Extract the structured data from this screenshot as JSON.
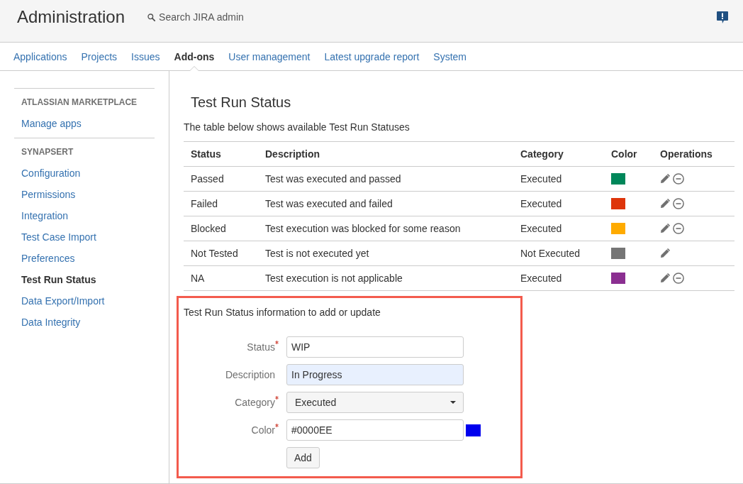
{
  "header": {
    "title": "Administration",
    "search": {
      "placeholder": "Search JIRA admin"
    }
  },
  "nav_tabs": [
    {
      "label": "Applications",
      "selected": false
    },
    {
      "label": "Projects",
      "selected": false
    },
    {
      "label": "Issues",
      "selected": false
    },
    {
      "label": "Add-ons",
      "selected": true
    },
    {
      "label": "User management",
      "selected": false
    },
    {
      "label": "Latest upgrade report",
      "selected": false
    },
    {
      "label": "System",
      "selected": false
    }
  ],
  "sidebar": {
    "sections": [
      {
        "heading": "ATLASSIAN MARKETPLACE",
        "items": [
          {
            "label": "Manage apps",
            "selected": false
          }
        ]
      },
      {
        "heading": "SYNAPSERT",
        "items": [
          {
            "label": "Configuration",
            "selected": false
          },
          {
            "label": "Permissions",
            "selected": false
          },
          {
            "label": "Integration",
            "selected": false
          },
          {
            "label": "Test Case Import",
            "selected": false
          },
          {
            "label": "Preferences",
            "selected": false
          },
          {
            "label": "Test Run Status",
            "selected": true
          },
          {
            "label": "Data Export/Import",
            "selected": false
          },
          {
            "label": "Data Integrity",
            "selected": false
          }
        ]
      }
    ]
  },
  "page": {
    "title": "Test Run Status",
    "intro": "The table below shows available Test Run Statuses"
  },
  "table": {
    "columns": [
      "Status",
      "Description",
      "Category",
      "Color",
      "Operations"
    ],
    "rows": [
      {
        "status": "Passed",
        "description": "Test was executed and passed",
        "category": "Executed",
        "color": "#00875a",
        "deletable": true
      },
      {
        "status": "Failed",
        "description": "Test was executed and failed",
        "category": "Executed",
        "color": "#de350b",
        "deletable": true
      },
      {
        "status": "Blocked",
        "description": "Test execution was blocked for some reason",
        "category": "Executed",
        "color": "#ffab00",
        "deletable": true
      },
      {
        "status": "Not Tested",
        "description": "Test is not executed yet",
        "category": "Not Executed",
        "color": "#757575",
        "deletable": false
      },
      {
        "status": "NA",
        "description": "Test execution is not applicable",
        "category": "Executed",
        "color": "#8b2f91",
        "deletable": true
      }
    ]
  },
  "form": {
    "outlined": true,
    "heading": "Test Run Status information to add or update",
    "fields": [
      {
        "kind": "text",
        "label": "Status",
        "required": true,
        "value": "WIP",
        "highlighted": false
      },
      {
        "kind": "text",
        "label": "Description",
        "required": false,
        "value": "In Progress",
        "highlighted": true
      },
      {
        "kind": "select",
        "label": "Category",
        "required": true,
        "value": "Executed",
        "highlighted": false
      },
      {
        "kind": "color",
        "label": "Color",
        "required": true,
        "value": "#0000EE",
        "highlighted": false,
        "color": "#0000ee"
      }
    ],
    "submit": "Add"
  }
}
